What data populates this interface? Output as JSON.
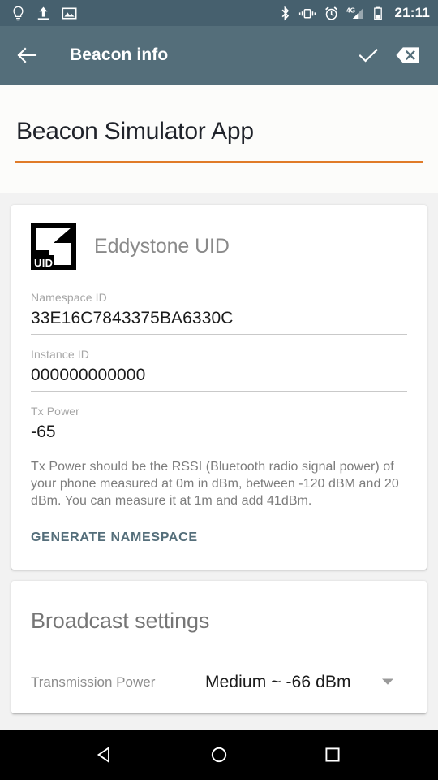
{
  "status_bar": {
    "background": "#46606e",
    "left_icons": [
      {
        "name": "lightbulb-icon"
      },
      {
        "name": "upload-icon"
      },
      {
        "name": "image-icon"
      }
    ],
    "right_icons": [
      {
        "name": "bluetooth-icon"
      },
      {
        "name": "vibrate-icon"
      },
      {
        "name": "alarm-clock-icon"
      },
      {
        "name": "signal-4g-icon",
        "label": "4G"
      },
      {
        "name": "battery-icon"
      }
    ],
    "clock": "21:11"
  },
  "app_bar": {
    "background": "#546e7a",
    "back_icon": "arrow-back-icon",
    "title": "Beacon info",
    "actions": [
      {
        "name": "confirm-check-icon"
      },
      {
        "name": "clear-backspace-icon"
      }
    ]
  },
  "page": {
    "title": "Beacon Simulator App",
    "accent_color": "#e07b28"
  },
  "beacon_card": {
    "logo_name": "eddystone-uid-logo",
    "logo_text": "UID",
    "heading": "Eddystone UID",
    "fields": [
      {
        "label": "Namespace ID",
        "value": "33E16C7843375BA6330C"
      },
      {
        "label": "Instance ID",
        "value": "000000000000"
      },
      {
        "label": "Tx Power",
        "value": "-65"
      }
    ],
    "help_text": "Tx Power should be the RSSI (Bluetooth radio signal power) of your phone measured at 0m in dBm, between -120 dBM and 20 dBm. You can measure it at 1m and add 41dBm.",
    "generate_button": "GENERATE NAMESPACE"
  },
  "broadcast_card": {
    "heading": "Broadcast settings",
    "transmission_power": {
      "label": "Transmission Power",
      "value": "Medium ~ -66 dBm",
      "dropdown_icon": "chevron-down-icon"
    }
  },
  "nav_bar": {
    "back": "nav-back-icon",
    "home": "nav-home-icon",
    "recents": "nav-recents-icon"
  }
}
